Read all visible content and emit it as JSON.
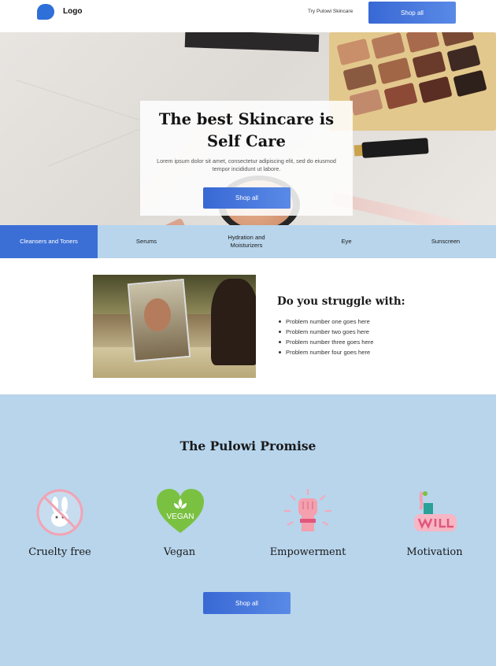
{
  "header": {
    "logo_label": "Logo",
    "nav_link": "Try Pulowi Skincare",
    "shop_button": "Shop all"
  },
  "hero": {
    "title": "The best Skincare is Self Care",
    "subtitle": "Lorem ipsum dolor sit amet, consectetur adipiscing elit, sed do eiusmod tempor incididunt ut labore.",
    "shop_button": "Shop all"
  },
  "categories": {
    "items": [
      {
        "label": "Cleansers and Toners",
        "active": true
      },
      {
        "label": "Serums",
        "active": false
      },
      {
        "label": "Hydration and Moisturizers",
        "active": false
      },
      {
        "label": "Eye",
        "active": false
      },
      {
        "label": "Sunscreen",
        "active": false
      }
    ],
    "active_color": "#3b6fd5"
  },
  "struggle": {
    "title": "Do you struggle with:",
    "problems": [
      "Problem number one goes here",
      "Problem number two goes here",
      "Problem number three goes here",
      "Problem number four goes here"
    ]
  },
  "promise": {
    "title": "The Pulowi Promise",
    "items": [
      {
        "label": "Cruelty free",
        "icon": "bunny-crossed-icon"
      },
      {
        "label": "Vegan",
        "icon": "vegan-heart-icon",
        "badge_text": "VEGAN"
      },
      {
        "label": "Empowerment",
        "icon": "raised-fist-icon"
      },
      {
        "label": "Motivation",
        "icon": "motivation-sticker-icon"
      }
    ],
    "shop_button": "Shop all"
  },
  "colors": {
    "accent_blue": "#3868d4",
    "section_blue": "#b8d5ec",
    "vegan_green": "#7ac142",
    "pink": "#f2a3b3"
  }
}
